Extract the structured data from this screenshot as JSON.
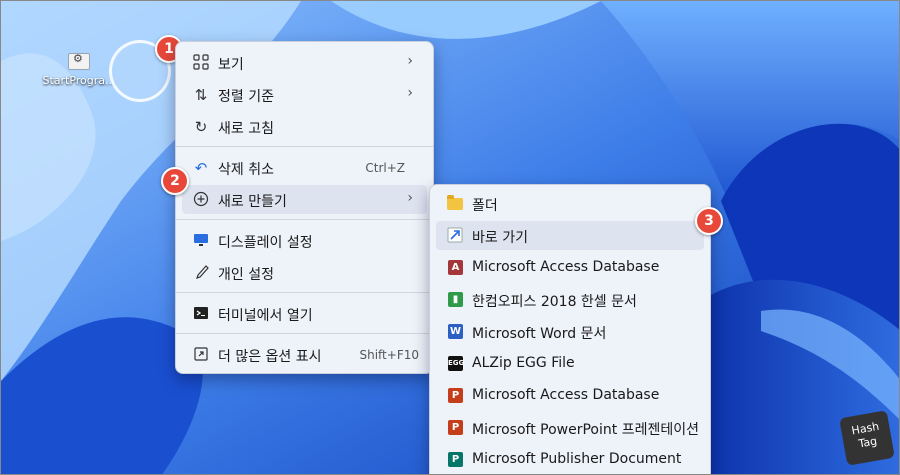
{
  "desktop": {
    "icon_label": "StartProgra..."
  },
  "steps": {
    "one": "1",
    "two": "2",
    "three": "3"
  },
  "context_menu": {
    "view": "보기",
    "sort": "정렬 기준",
    "refresh": "새로 고침",
    "undo_delete": "삭제 취소",
    "undo_shortcut": "Ctrl+Z",
    "new": "새로 만들기",
    "display_settings": "디스플레이 설정",
    "personalize": "개인 설정",
    "open_terminal": "터미널에서 열기",
    "show_more": "더 많은 옵션 표시",
    "show_more_shortcut": "Shift+F10"
  },
  "submenu": {
    "folder": "폴더",
    "shortcut": "바로 가기",
    "access_db_1": "Microsoft Access Database",
    "hancell": "한컴오피스 2018 한셀 문서",
    "word": "Microsoft Word 문서",
    "alzip": "ALZip EGG File",
    "access_db_2": "Microsoft Access Database",
    "powerpoint": "Microsoft PowerPoint 프레젠테이션",
    "publisher": "Microsoft Publisher Document"
  },
  "icons": {
    "view": "grid-icon",
    "sort": "sort-arrows-icon",
    "refresh": "refresh-icon",
    "undo": "undo-icon",
    "new": "plus-circle-icon",
    "display": "monitor-icon",
    "personalize": "brush-icon",
    "terminal": "terminal-icon",
    "more": "expand-icon"
  },
  "watermark": {
    "line1": "Hash",
    "line2": "Tag"
  },
  "colors": {
    "badge": "#e8483a",
    "menu_bg": "#eef2f9",
    "highlight": "#dde3ef"
  }
}
